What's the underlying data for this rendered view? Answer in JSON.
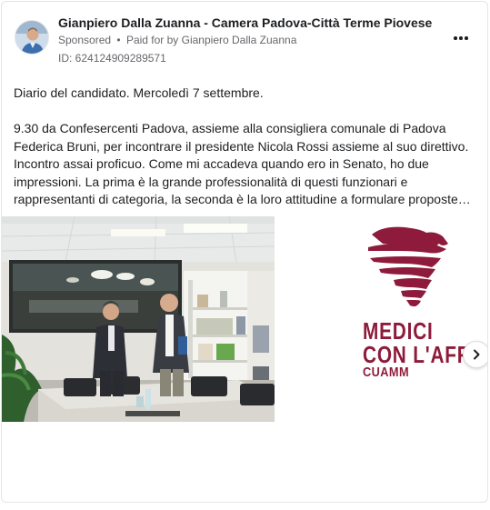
{
  "header": {
    "page_name": "Gianpiero Dalla Zuanna - Camera Padova-Città Terme Piovese",
    "sponsored_label": "Sponsored",
    "separator": "•",
    "paid_for": "Paid for by Gianpiero Dalla Zuanna",
    "ad_id": "ID: 624124909289571",
    "more_icon": "more-horizontal-icon"
  },
  "post": {
    "lines_p1": [
      "Diario del candidato. Mercoledì 7 settembre."
    ],
    "lines_p2": [
      "9.30 da Confesercenti Padova, assieme alla consigliera comunale di Padova",
      "Federica Bruni, per incontrare il presidente Nicola Rossi assieme al suo direttivo.",
      "Incontro assai proficuo. Come mi accadeva quando ero in Senato, ho due",
      "impressioni. La prima è la grande professionalità di questi funzionari e",
      "rappresentanti di categoria, la seconda è la loro attitudine a formulare proposte…"
    ]
  },
  "carousel": {
    "slide_2_logo": {
      "line1": "MEDICI",
      "line2": "CON L'AFR",
      "line3": "CUAMM"
    },
    "next_icon": "chevron-right-icon"
  },
  "colors": {
    "brand": "#8e1b3b",
    "text": "#1c1e21",
    "secondary": "#65676b",
    "border": "#e3e5e8"
  }
}
